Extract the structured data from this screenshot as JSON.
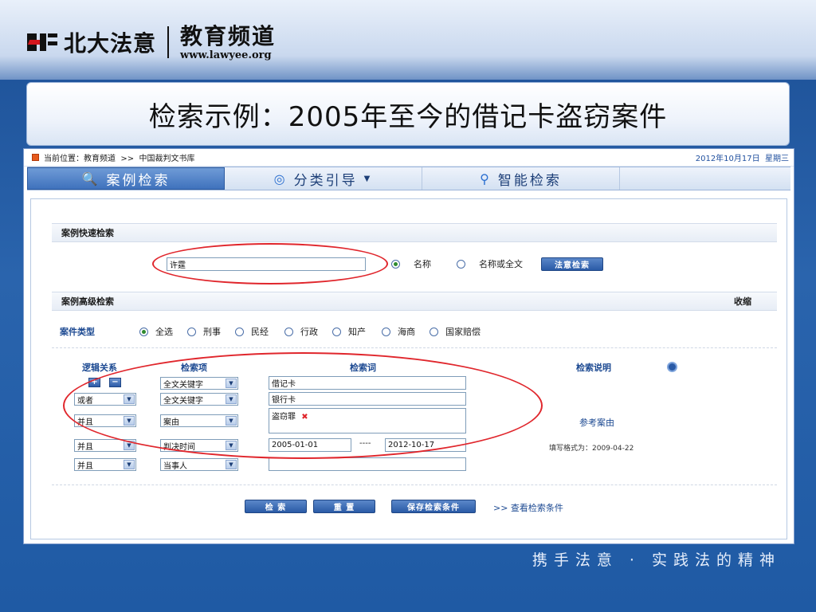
{
  "brand": {
    "name": "北大法意",
    "channel": "教育频道",
    "url": "www.lawyee.org"
  },
  "slide_title": "检索示例：2005年至今的借记卡盗窃案件",
  "topbar": {
    "location_prefix": "当前位置：",
    "breadcrumb": "教育频道  >>  中国裁判文书库",
    "date": "2012年10月17日  星期三"
  },
  "tabs": [
    {
      "label": "案例检索",
      "icon": "search-icon",
      "active": true
    },
    {
      "label": "分类引导",
      "icon": "circle-target-icon",
      "active": false,
      "dropdown": true
    },
    {
      "label": "智能检索",
      "icon": "search-icon",
      "active": false
    }
  ],
  "quick_search": {
    "heading": "案例快速检索",
    "input_value": "许霆",
    "options": [
      {
        "label": "名称",
        "selected": true
      },
      {
        "label": "名称或全文",
        "selected": false
      }
    ],
    "button": "法意检索"
  },
  "advanced_search": {
    "heading": "案例高级检索",
    "collapse": "收缩",
    "case_type_label": "案件类型",
    "case_types": [
      {
        "label": "全选",
        "selected": true
      },
      {
        "label": "刑事",
        "selected": false
      },
      {
        "label": "民经",
        "selected": false
      },
      {
        "label": "行政",
        "selected": false
      },
      {
        "label": "知产",
        "selected": false
      },
      {
        "label": "海商",
        "selected": false
      },
      {
        "label": "国家赔偿",
        "selected": false
      }
    ],
    "columns": {
      "logic": "逻辑关系",
      "field": "检索项",
      "term": "检索词",
      "help": "检索说明"
    },
    "add_symbol": "+",
    "remove_symbol": "−",
    "rows": [
      {
        "logic": "",
        "field": "全文关键字",
        "term": "借记卡"
      },
      {
        "logic": "或者",
        "field": "全文关键字",
        "term": "银行卡"
      },
      {
        "logic": "并且",
        "field": "案由",
        "term": "盗窃罪"
      },
      {
        "logic": "并且",
        "field": "判决时间",
        "term_from": "2005-01-01",
        "range_sep": "----",
        "term_to": "2012-10-17"
      },
      {
        "logic": "并且",
        "field": "当事人",
        "term": ""
      }
    ],
    "reference_link": "参考案由",
    "date_hint": "填写格式为：2009-04-22",
    "buttons": {
      "search": "检  索",
      "reset": "重  置",
      "save": "保存检索条件"
    },
    "view_conditions": ">> 查看检索条件"
  },
  "slogan": "携手法意 · 实践法的精神",
  "colors": {
    "background": "#1f5aa4",
    "accent": "#2a5aa6",
    "highlight_ellipse": "#e0262c"
  }
}
